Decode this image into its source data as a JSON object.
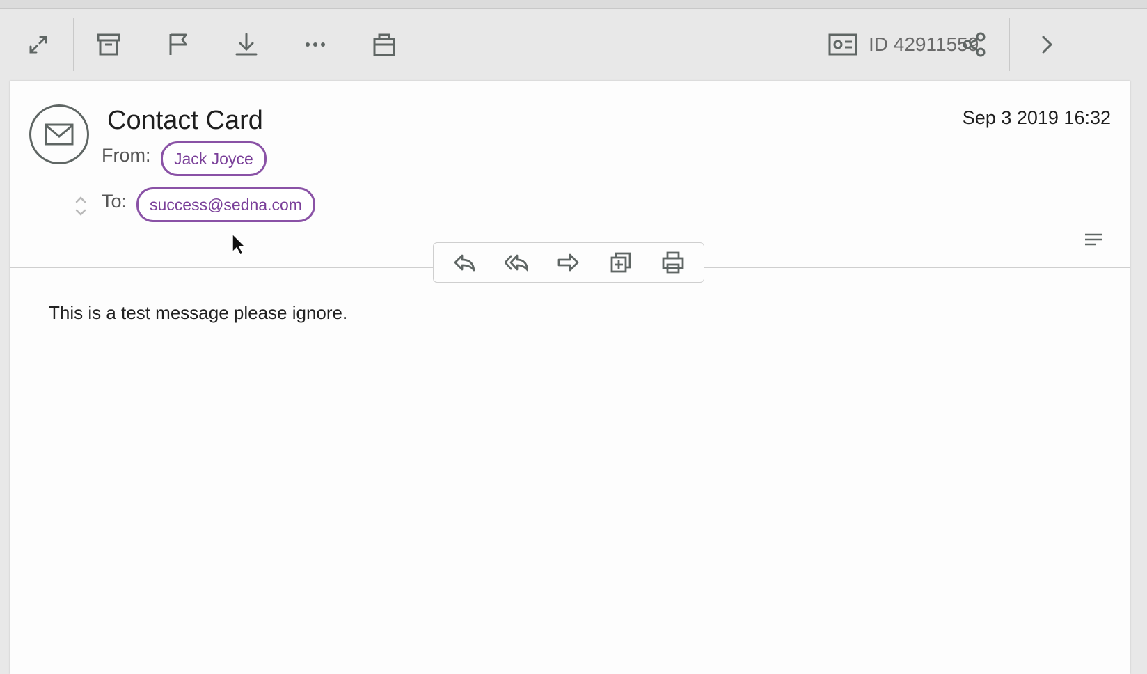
{
  "toolbar": {
    "buttons": [
      {
        "name": "expand-icon"
      },
      {
        "name": "archive-icon"
      },
      {
        "name": "flag-icon"
      },
      {
        "name": "download-icon"
      },
      {
        "name": "more-icon"
      },
      {
        "name": "briefcase-icon"
      }
    ],
    "id_label": "ID 42911559",
    "share_icon": "share-icon",
    "next_icon": "chevron-right-icon"
  },
  "message": {
    "subject": "Contact Card",
    "date": "Sep 3 2019 16:32",
    "from_label": "From:",
    "from": "Jack Joyce",
    "to_label": "To:",
    "to": "success@sedna.com",
    "body": "This is a test message please ignore."
  },
  "actions": [
    "reply-icon",
    "reply-all-icon",
    "forward-icon",
    "copy-icon",
    "print-icon"
  ],
  "colors": {
    "accent": "#8a52a6",
    "icon": "#5f6664",
    "toolbar_bg": "#e8e8e8"
  }
}
